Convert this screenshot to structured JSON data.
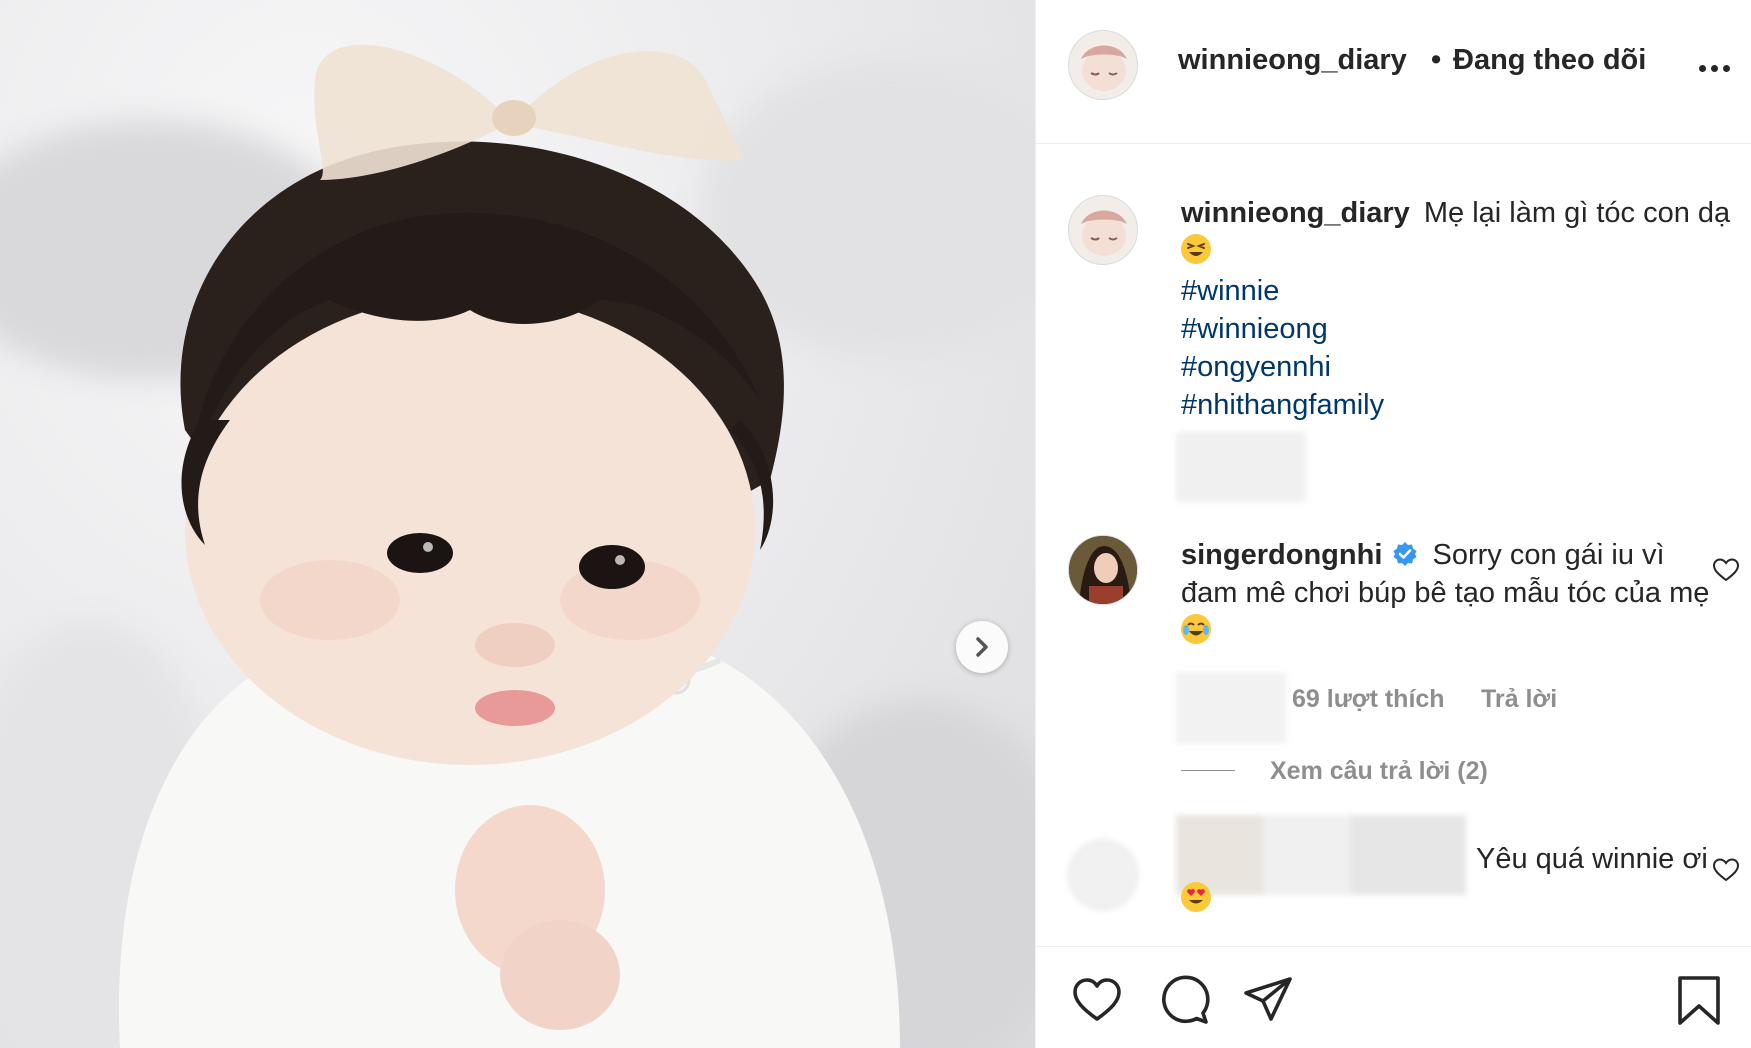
{
  "post": {
    "username": "winnieong_diary",
    "follow_separator": "•",
    "follow_status": "Đang theo dõi"
  },
  "caption": {
    "username": "winnieong_diary",
    "text": "Mẹ lại làm gì tóc con dạ",
    "emoji": "grinning-squinting-face",
    "hashtags": [
      "#winnie",
      "#winnieong",
      "#ongyennhi",
      "#nhithangfamily"
    ]
  },
  "comments": [
    {
      "username": "singerdongnhi",
      "verified": true,
      "text": "Sorry con gái iu vì đam mê chơi búp bê tạo mẫu tóc của mẹ",
      "emoji": "face-with-tears-of-joy",
      "likes_label": "69 lượt thích",
      "reply_label": "Trả lời",
      "view_replies_label": "Xem câu trả lời (2)"
    },
    {
      "username": "",
      "text": "Yêu quá winnie ơi",
      "emoji": "smiling-face-with-heart-eyes"
    }
  ],
  "icons": {
    "more": "more-icon",
    "next": "chevron-right-icon",
    "like": "heart-icon",
    "comment": "comment-icon",
    "share": "paper-plane-icon",
    "save": "bookmark-icon",
    "verified": "verified-badge-icon"
  },
  "colors": {
    "text": "#262626",
    "muted": "#8e8e8e",
    "hashtag": "#00376b",
    "verified": "#3897f0",
    "divider": "#efefef"
  }
}
